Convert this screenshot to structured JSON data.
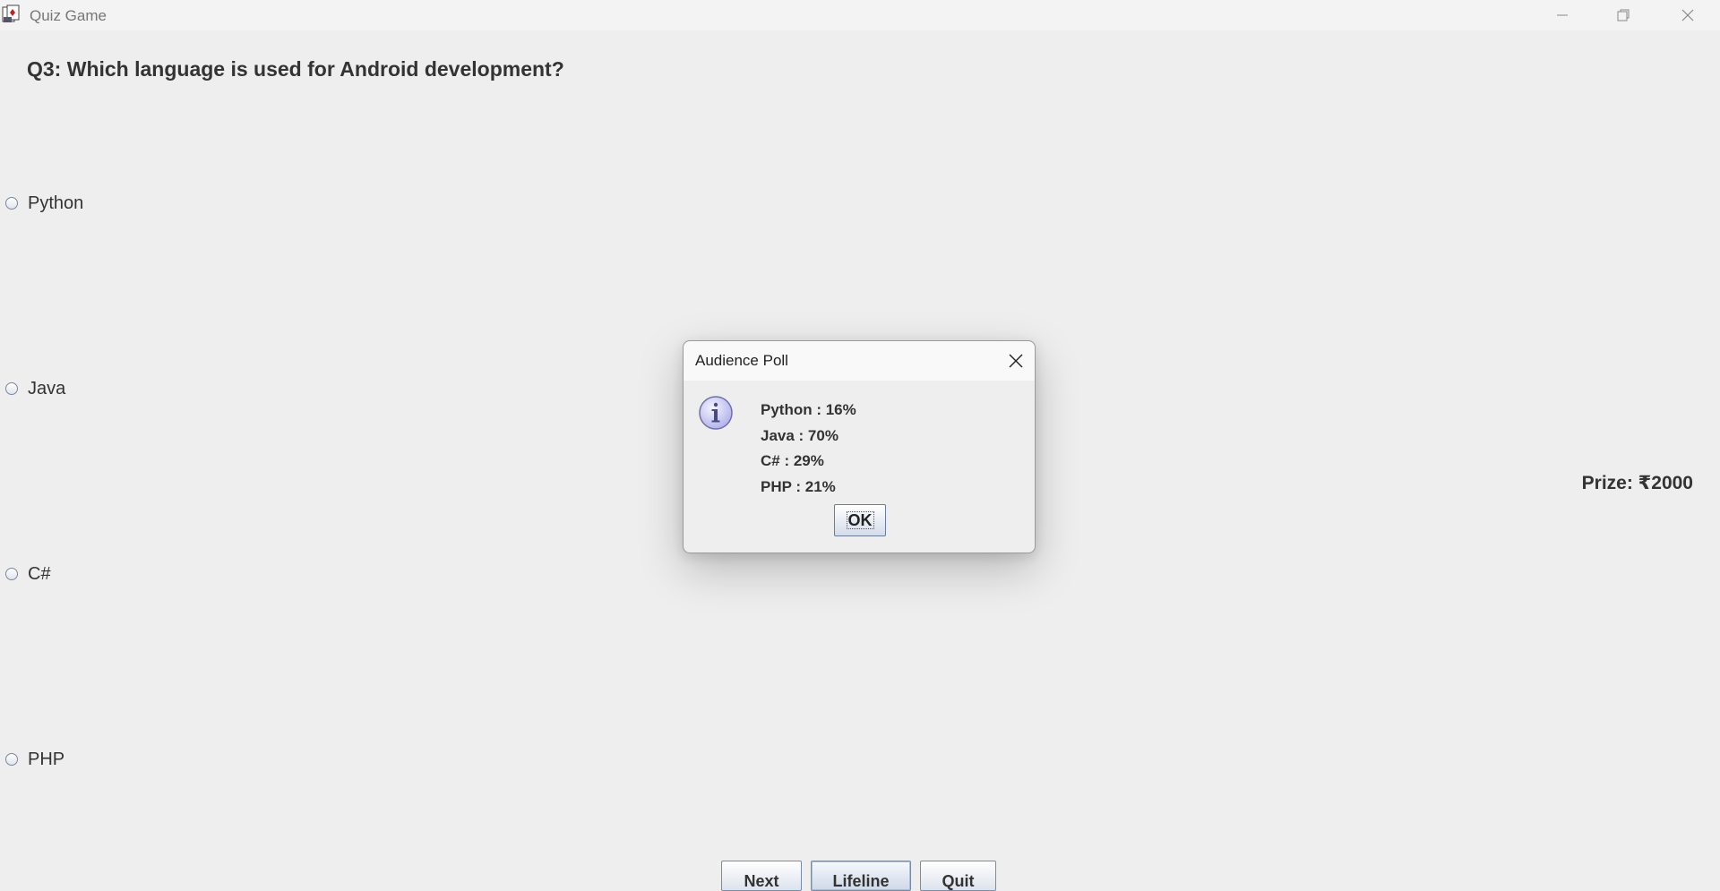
{
  "window": {
    "title": "Quiz Game",
    "controls": {
      "minimize": "minimize-icon",
      "maximize": "restore-icon",
      "close": "close-icon"
    }
  },
  "quiz": {
    "question": "Q3: Which language is used for Android development?",
    "options": [
      {
        "label": "Python"
      },
      {
        "label": "Java"
      },
      {
        "label": "C#"
      },
      {
        "label": "PHP"
      }
    ],
    "prize": "Prize: ₹2000"
  },
  "buttons": {
    "next": "Next",
    "lifeline": "Lifeline",
    "quit": "Quit"
  },
  "dialog": {
    "title": "Audience Poll",
    "icon": "info-icon",
    "lines": [
      "Python : 16%",
      "Java : 70%",
      "C# : 29%",
      "PHP : 21%"
    ],
    "ok": "OK"
  },
  "colors": {
    "background": "#eeeeee",
    "text": "#333333",
    "button_border": "#7a8ca8",
    "info_icon": "#c8c8f4"
  }
}
